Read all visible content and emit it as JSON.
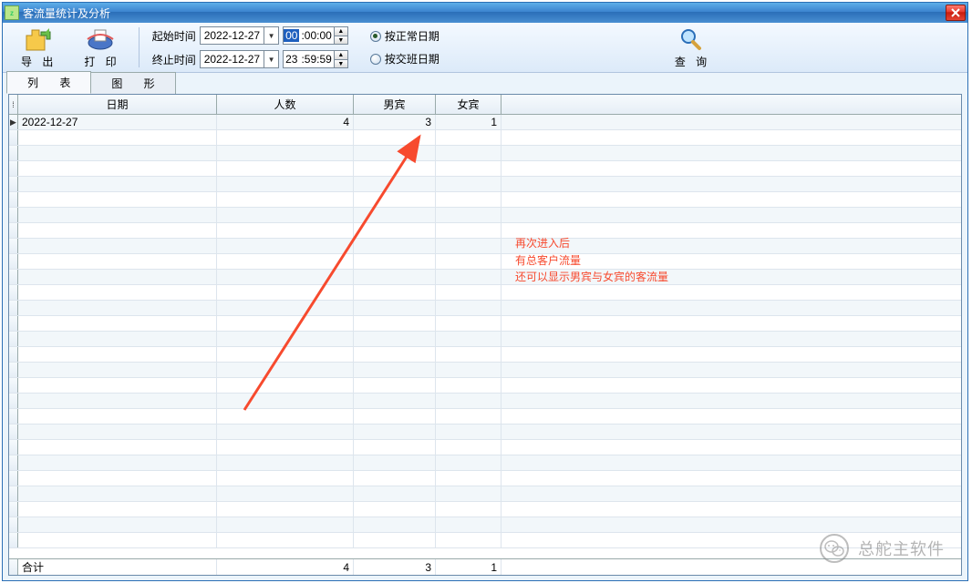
{
  "window": {
    "title": "客流量统计及分析"
  },
  "toolbar": {
    "export_label": "导 出",
    "print_label": "打 印",
    "query_label": "查 询",
    "start_time_label": "起始时间",
    "end_time_label": "终止时间",
    "start_date": "2022-12-27",
    "end_date": "2022-12-27",
    "start_time_hour": "00",
    "start_time_rest": ":00:00",
    "end_time_hour": "23",
    "end_time_rest": ":59:59",
    "radio_normal": "按正常日期",
    "radio_shift": "按交班日期",
    "radio_selected": "normal"
  },
  "tabs": {
    "list_label": "列   表",
    "chart_label": "图   形",
    "active": "list"
  },
  "grid": {
    "headers": {
      "date": "日期",
      "count": "人数",
      "male": "男宾",
      "female": "女宾"
    },
    "rows": [
      {
        "date": "2022-12-27",
        "count": "4",
        "male": "3",
        "female": "1"
      }
    ],
    "empty_row_count": 27,
    "footer": {
      "label": "合计",
      "count": "4",
      "male": "3",
      "female": "1"
    }
  },
  "annotation": {
    "line1": "再次进入后",
    "line2": "有总客户流量",
    "line3": "还可以显示男宾与女宾的客流量"
  },
  "watermark": {
    "text": "总舵主软件"
  }
}
